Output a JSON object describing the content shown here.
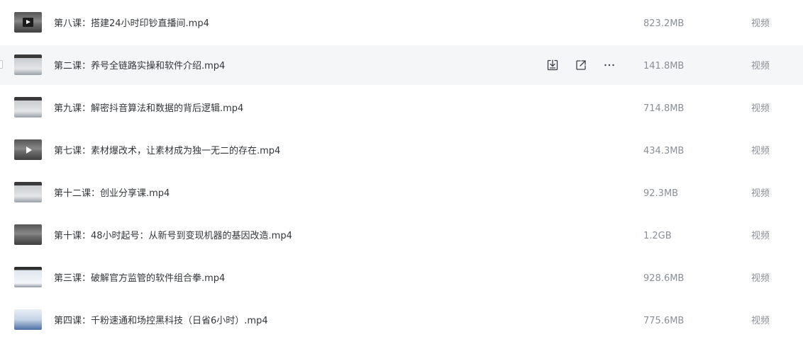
{
  "files": [
    {
      "name": "第八课：搭建24小时印钞直播间.mp4",
      "size": "823.2MB",
      "type": "视频",
      "thumb": "dark-play"
    },
    {
      "name": "第二课：养号全链路实操和软件介绍.mp4",
      "size": "141.8MB",
      "type": "视频",
      "thumb": "screen",
      "hovered": true
    },
    {
      "name": "第九课：解密抖音算法和数据的背后逻辑.mp4",
      "size": "714.8MB",
      "type": "视频",
      "thumb": "screen"
    },
    {
      "name": " 第七课：素材爆改术，让素材成为独一无二的存在.mp4",
      "size": "434.3MB",
      "type": "视频",
      "thumb": "dark-play"
    },
    {
      "name": "第十二课：创业分享课.mp4",
      "size": "92.3MB",
      "type": "视频",
      "thumb": "screen"
    },
    {
      "name": "第十课：48小时起号：从新号到变现机器的基因改造.mp4",
      "size": "1.2GB",
      "type": "视频",
      "thumb": "dark"
    },
    {
      "name": "第三课：破解官方监管的软件组合拳.mp4",
      "size": "928.6MB",
      "type": "视频",
      "thumb": "light"
    },
    {
      "name": " 第四课：千粉速通和场控黑科技（日省6小时）.mp4",
      "size": "775.6MB",
      "type": "视频",
      "thumb": "bright"
    }
  ],
  "row_actions": {
    "download_icon": "download-icon",
    "share_icon": "share-icon",
    "more_icon": "more-icon"
  },
  "colors": {
    "hover_bg": "#f5f6f8",
    "text_primary": "#333639",
    "text_secondary": "#8a8f96"
  }
}
